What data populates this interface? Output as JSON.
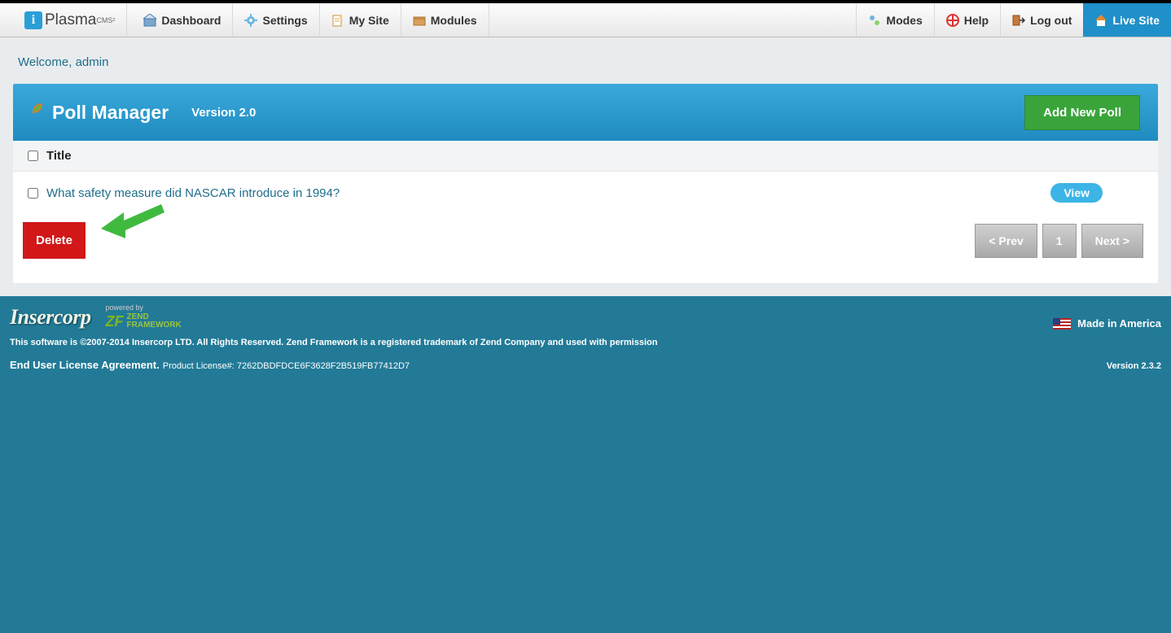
{
  "brand": {
    "name": "Plasma",
    "suffix": "CMS²"
  },
  "nav": {
    "left": [
      {
        "label": "Dashboard",
        "name": "nav-dashboard",
        "icon": "dashboard-icon"
      },
      {
        "label": "Settings",
        "name": "nav-settings",
        "icon": "settings-icon"
      },
      {
        "label": "My Site",
        "name": "nav-mysite",
        "icon": "mysite-icon"
      },
      {
        "label": "Modules",
        "name": "nav-modules",
        "icon": "modules-icon"
      }
    ],
    "right": [
      {
        "label": "Modes",
        "name": "nav-modes",
        "icon": "modes-icon"
      },
      {
        "label": "Help",
        "name": "nav-help",
        "icon": "help-icon"
      },
      {
        "label": "Log out",
        "name": "nav-logout",
        "icon": "logout-icon"
      },
      {
        "label": "Live Site",
        "name": "nav-livesite",
        "icon": "home-icon",
        "live": true
      }
    ]
  },
  "welcome": "Welcome, admin",
  "module": {
    "title": "Poll Manager",
    "version": "Version 2.0",
    "add_label": "Add New Poll",
    "column_header": "Title",
    "rows": [
      {
        "title": "What safety measure did NASCAR introduce in 1994?",
        "view_label": "View"
      }
    ],
    "delete_label": "Delete",
    "pager": {
      "prev": "< Prev",
      "page": "1",
      "next": "Next >"
    }
  },
  "footer": {
    "insercorp": "Insercorp",
    "powered_by": "powered by",
    "zend_top": "ZEND",
    "zend_bottom": "FRAMEWORK",
    "made_in": "Made in America",
    "copyright": "This software is ©2007-2014 Insercorp LTD. All Rights Reserved. Zend Framework is a registered trademark of Zend Company and used with permission",
    "eula": "End User License Agreement.",
    "license": "Product License#: 7262DBDFDCE6F3628F2B519FB77412D7",
    "version": "Version 2.3.2"
  }
}
